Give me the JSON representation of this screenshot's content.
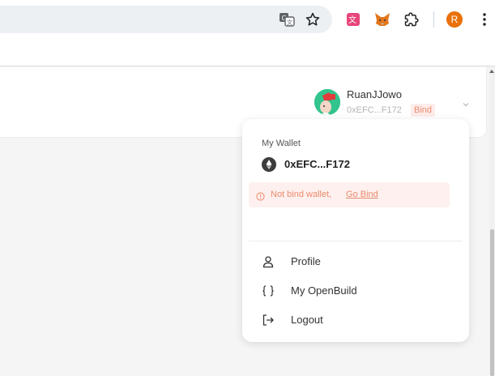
{
  "browser": {
    "icons": [
      "translate-icon",
      "star-icon",
      "extension-icon",
      "metamask-fox-icon",
      "puzzle-icon",
      "profile-icon",
      "kebab-menu-icon"
    ],
    "profile_initial": "R",
    "profile_color": "#e8710a"
  },
  "header": {
    "username": "RuanJJowo",
    "address_short": "0xEFC...F172",
    "bind_label": "Bind"
  },
  "dropdown": {
    "wallet_label": "My Wallet",
    "wallet_address": "0xEFC...F172",
    "warning_text": "Not bind wallet,",
    "warning_link": "Go Bind",
    "menu": [
      {
        "label": "Profile",
        "icon": "user-icon"
      },
      {
        "label": "My OpenBuild",
        "icon": "braces-icon"
      },
      {
        "label": "Logout",
        "icon": "logout-icon"
      }
    ]
  },
  "colors": {
    "accent": "#ea8b6d",
    "warning_bg": "#fdf0ee",
    "avatar_bg": "#33c48e"
  }
}
